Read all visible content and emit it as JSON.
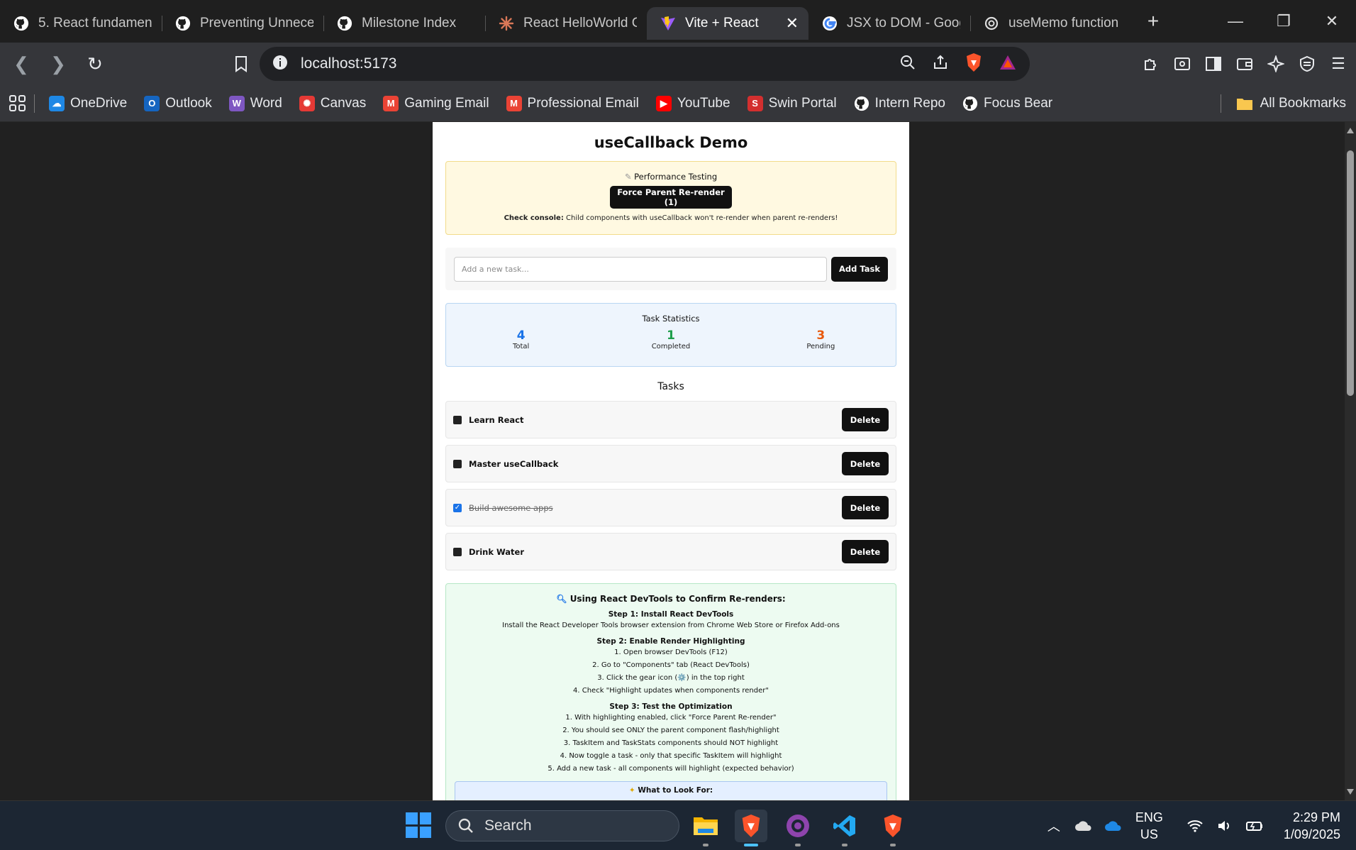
{
  "browser": {
    "tabs": [
      {
        "title": "5. React fundament",
        "icon": "github-icon",
        "active": false
      },
      {
        "title": "Preventing Unneces",
        "icon": "github-icon",
        "active": false
      },
      {
        "title": "Milestone Index",
        "icon": "github-icon",
        "active": false
      },
      {
        "title": "React HelloWorld C",
        "icon": "claude-icon",
        "active": false
      },
      {
        "title": "Vite + React",
        "icon": "vite-icon",
        "active": true
      },
      {
        "title": "JSX to DOM - Goog",
        "icon": "google-icon",
        "active": false
      },
      {
        "title": "useMemo function",
        "icon": "chatgpt-icon",
        "active": false
      }
    ],
    "new_tab": "+",
    "url": "localhost:5173",
    "bookmarks": [
      {
        "label": "OneDrive",
        "color": "#1e88e5"
      },
      {
        "label": "Outlook",
        "color": "#1565c0"
      },
      {
        "label": "Word",
        "color": "#7e57c2"
      },
      {
        "label": "Canvas",
        "color": "#e53935"
      },
      {
        "label": "Gaming Email",
        "color": "#ea4335"
      },
      {
        "label": "Professional Email",
        "color": "#ea4335"
      },
      {
        "label": "YouTube",
        "color": "#ff0000"
      },
      {
        "label": "Swin Portal",
        "color": "#d32f2f"
      },
      {
        "label": "Intern Repo",
        "color": "#ffffff"
      },
      {
        "label": "Focus Bear",
        "color": "#ffffff"
      }
    ],
    "all_bookmarks": "All Bookmarks"
  },
  "app": {
    "title": "useCallback Demo",
    "perf": {
      "title": "Performance Testing",
      "button": "Force Parent Re-render (1)",
      "note_bold": "Check console:",
      "note": "Child components with useCallback won't re-render when parent re-renders!"
    },
    "add": {
      "placeholder": "Add a new task...",
      "button": "Add Task"
    },
    "stats": {
      "title": "Task Statistics",
      "items": [
        {
          "value": "4",
          "label": "Total",
          "color": "#1a73e8"
        },
        {
          "value": "1",
          "label": "Completed",
          "color": "#1e9e4a"
        },
        {
          "value": "3",
          "label": "Pending",
          "color": "#e8590c"
        }
      ]
    },
    "tasks_heading": "Tasks",
    "tasks": [
      {
        "name": "Learn React",
        "completed": false,
        "delete": "Delete"
      },
      {
        "name": "Master useCallback",
        "completed": false,
        "delete": "Delete"
      },
      {
        "name": "Build awesome apps",
        "completed": true,
        "delete": "Delete"
      },
      {
        "name": "Drink Water",
        "completed": false,
        "delete": "Delete"
      }
    ],
    "guide": {
      "title": "Using React DevTools to Confirm Re-renders:",
      "step1_title": "Step 1: Install React DevTools",
      "step1_text": "Install the React Developer Tools browser extension from Chrome Web Store or Firefox Add-ons",
      "step2_title": "Step 2: Enable Render Highlighting",
      "step2_lines": [
        "1. Open browser DevTools (F12)",
        "2. Go to \"Components\" tab (React DevTools)",
        "3. Click the gear icon (⚙️) in the top right",
        "4. Check \"Highlight updates when components render\""
      ],
      "step3_title": "Step 3: Test the Optimization",
      "step3_lines": [
        "1. With highlighting enabled, click \"Force Parent Re-render\"",
        "2. You should see ONLY the parent component flash/highlight",
        "3. TaskItem and TaskStats components should NOT highlight",
        "4. Now toggle a task - only that specific TaskItem will highlight",
        "5. Add a new task - all components will highlight (expected behavior)"
      ],
      "look_title": "What to Look For:"
    }
  },
  "taskbar": {
    "search": "Search",
    "lang": "ENG",
    "region": "US",
    "time": "2:29 PM",
    "date": "1/09/2025"
  }
}
